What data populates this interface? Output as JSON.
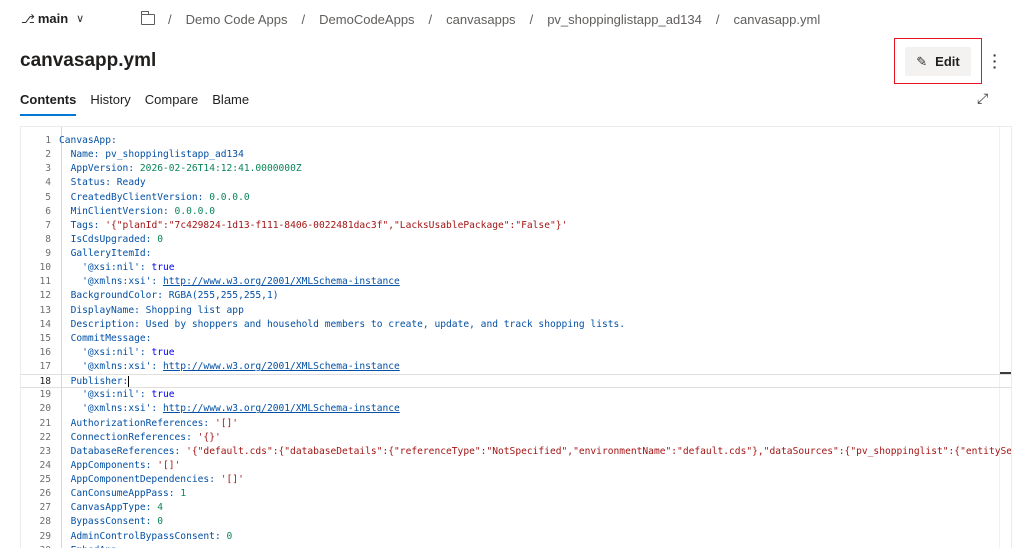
{
  "branch": {
    "name": "main"
  },
  "breadcrumb": [
    "Demo Code Apps",
    "DemoCodeApps",
    "canvasapps",
    "pv_shoppinglistapp_ad134",
    "canvasapp.yml"
  ],
  "title": "canvasapp.yml",
  "edit_label": "Edit",
  "tabs": [
    "Contents",
    "History",
    "Compare",
    "Blame"
  ],
  "active_tab": "Contents",
  "current_line": 18,
  "code_lines": [
    {
      "n": "1",
      "key": "CanvasApp",
      "indent": 0,
      "val": "",
      "vt": ""
    },
    {
      "n": "2",
      "key": "Name",
      "indent": 1,
      "val": "pv_shoppinglistapp_ad134",
      "vt": "k"
    },
    {
      "n": "3",
      "key": "AppVersion",
      "indent": 1,
      "val": "2026-02-26T14:12:41.0000000Z",
      "vt": "n"
    },
    {
      "n": "4",
      "key": "Status",
      "indent": 1,
      "val": "Ready",
      "vt": "k"
    },
    {
      "n": "5",
      "key": "CreatedByClientVersion",
      "indent": 1,
      "val": "0.0.0.0",
      "vt": "n"
    },
    {
      "n": "6",
      "key": "MinClientVersion",
      "indent": 1,
      "val": "0.0.0.0",
      "vt": "n"
    },
    {
      "n": "7",
      "key": "Tags",
      "indent": 1,
      "val": "'{\"planId\":\"7c429824-1d13-f111-8406-0022481dac3f\",\"LacksUsablePackage\":\"False\"}'",
      "vt": "s"
    },
    {
      "n": "8",
      "key": "IsCdsUpgraded",
      "indent": 1,
      "val": "0",
      "vt": "n"
    },
    {
      "n": "9",
      "key": "GalleryItemId",
      "indent": 1,
      "val": "",
      "vt": ""
    },
    {
      "n": "10",
      "key": "'@xsi:nil'",
      "indent": 2,
      "val": "true",
      "vt": "b"
    },
    {
      "n": "11",
      "key": "'@xmlns:xsi'",
      "indent": 2,
      "val": "http://www.w3.org/2001/XMLSchema-instance",
      "vt": "u"
    },
    {
      "n": "12",
      "key": "BackgroundColor",
      "indent": 1,
      "val": "RGBA(255,255,255,1)",
      "vt": "k"
    },
    {
      "n": "13",
      "key": "DisplayName",
      "indent": 1,
      "val": "Shopping list app",
      "vt": "k"
    },
    {
      "n": "14",
      "key": "Description",
      "indent": 1,
      "val": "Used by shoppers and household members to create, update, and track shopping lists.",
      "vt": "k"
    },
    {
      "n": "15",
      "key": "CommitMessage",
      "indent": 1,
      "val": "",
      "vt": ""
    },
    {
      "n": "16",
      "key": "'@xsi:nil'",
      "indent": 2,
      "val": "true",
      "vt": "b"
    },
    {
      "n": "17",
      "key": "'@xmlns:xsi'",
      "indent": 2,
      "val": "http://www.w3.org/2001/XMLSchema-instance",
      "vt": "u"
    },
    {
      "n": "18",
      "key": "Publisher",
      "indent": 1,
      "val": "",
      "vt": ""
    },
    {
      "n": "19",
      "key": "'@xsi:nil'",
      "indent": 2,
      "val": "true",
      "vt": "b"
    },
    {
      "n": "20",
      "key": "'@xmlns:xsi'",
      "indent": 2,
      "val": "http://www.w3.org/2001/XMLSchema-instance",
      "vt": "u"
    },
    {
      "n": "21",
      "key": "AuthorizationReferences",
      "indent": 1,
      "val": "'[]'",
      "vt": "s"
    },
    {
      "n": "22",
      "key": "ConnectionReferences",
      "indent": 1,
      "val": "'{}'",
      "vt": "s"
    },
    {
      "n": "23",
      "key": "DatabaseReferences",
      "indent": 1,
      "val": "'{\"default.cds\":{\"databaseDetails\":{\"referenceType\":\"NotSpecified\",\"environmentName\":\"default.cds\"},\"dataSources\":{\"pv_shoppinglist\":{\"entitySetName\"",
      "vt": "s"
    },
    {
      "n": "24",
      "key": "AppComponents",
      "indent": 1,
      "val": "'[]'",
      "vt": "s"
    },
    {
      "n": "25",
      "key": "AppComponentDependencies",
      "indent": 1,
      "val": "'[]'",
      "vt": "s"
    },
    {
      "n": "26",
      "key": "CanConsumeAppPass",
      "indent": 1,
      "val": "1",
      "vt": "n"
    },
    {
      "n": "27",
      "key": "CanvasAppType",
      "indent": 1,
      "val": "4",
      "vt": "n"
    },
    {
      "n": "28",
      "key": "BypassConsent",
      "indent": 1,
      "val": "0",
      "vt": "n"
    },
    {
      "n": "29",
      "key": "AdminControlBypassConsent",
      "indent": 1,
      "val": "0",
      "vt": "n"
    },
    {
      "n": "30",
      "key": "EmbedApp",
      "indent": 1,
      "val": "",
      "vt": ""
    }
  ],
  "colors": {
    "accent": "#0078d4",
    "highlight_border": "#e81123",
    "key": "#0451a5",
    "string": "#a31515",
    "number": "#098658",
    "bool": "#0000ff"
  },
  "icons": [
    "branch-icon",
    "chevron-down-icon",
    "folder-icon",
    "pencil-icon",
    "more-icon",
    "expand-icon"
  ]
}
